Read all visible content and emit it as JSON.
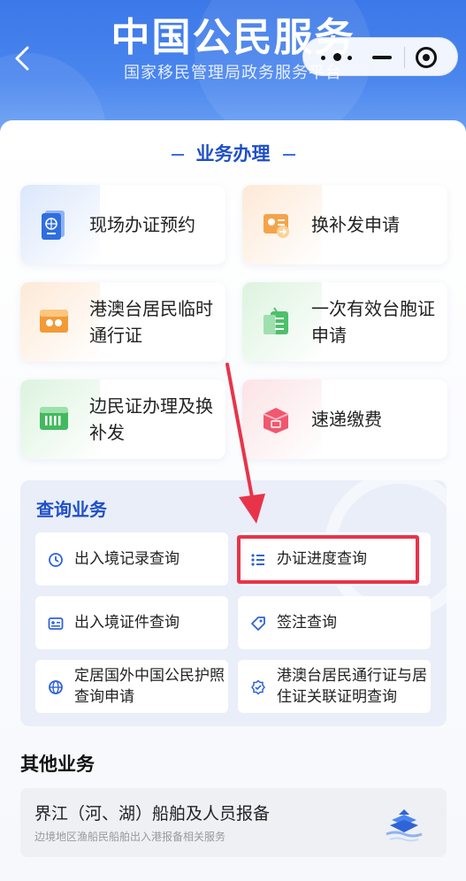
{
  "header": {
    "title": "中国公民服务",
    "subtitle": "国家移民管理局政务服务平台",
    "back_icon": "chevron-left-icon",
    "capsule_icons": [
      "more-icon",
      "minimize-icon",
      "record-icon"
    ]
  },
  "business": {
    "title": "业务办理",
    "cards": [
      {
        "label": "现场办证预约",
        "icon": "passport-icon"
      },
      {
        "label": "换补发申请",
        "icon": "id-card-icon"
      },
      {
        "label": "港澳台居民临时通行证",
        "icon": "permit-icon"
      },
      {
        "label": "一次有效台胞证申请",
        "icon": "document-icon"
      },
      {
        "label": "边民证办理及换补发",
        "icon": "border-card-icon"
      },
      {
        "label": "速递缴费",
        "icon": "parcel-icon"
      }
    ]
  },
  "query": {
    "title": "查询业务",
    "items": [
      {
        "label": "出入境记录查询",
        "icon": "clock-icon"
      },
      {
        "label": "办证进度查询",
        "icon": "list-icon"
      },
      {
        "label": "出入境证件查询",
        "icon": "card-icon"
      },
      {
        "label": "签注查询",
        "icon": "tag-icon"
      },
      {
        "label": "定居国外中国公民护照查询申请",
        "icon": "globe-icon"
      },
      {
        "label": "港澳台居民通行证与居住证关联证明查询",
        "icon": "badge-icon"
      }
    ]
  },
  "other": {
    "title": "其他业务",
    "card_title": "界江（河、湖）船舶及人员报备",
    "card_subtitle": "边境地区渔船民船舶出入港报备相关服务",
    "icon": "ship-icon"
  },
  "colors": {
    "primary": "#1f4fc8",
    "header": "#3c78e8",
    "highlight": "#e8344a"
  }
}
